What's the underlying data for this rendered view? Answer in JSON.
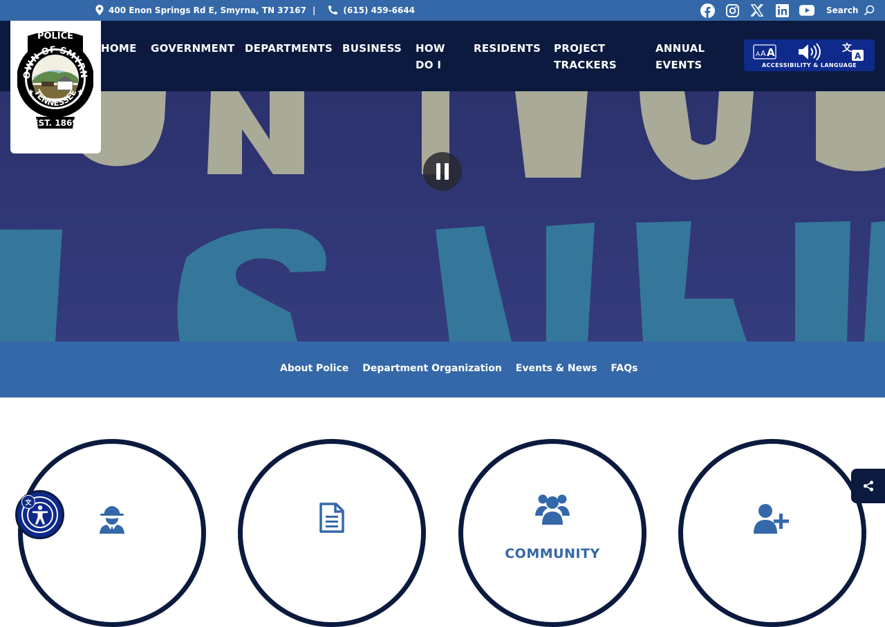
{
  "topbar": {
    "address": "400 Enon Springs Rd E, Smyrna, TN 37167",
    "separator": "|",
    "phone": "(615) 459-6644",
    "search_label": "Search",
    "social": [
      "facebook-icon",
      "instagram-icon",
      "x-icon",
      "linkedin-icon",
      "youtube-icon"
    ]
  },
  "logo": {
    "top_text": "POLICE",
    "ring_text": "TOWN OF SMYRNA",
    "bottom_text": "TENNESSEE",
    "est": "EST. 1869"
  },
  "nav": {
    "home": "HOME",
    "government": "GOVERNMENT",
    "departments": "DEPARTMENTS",
    "business": "BUSINESS",
    "how_do_i_1": "HOW",
    "how_do_i_2": "DO I",
    "residents": "RESIDENTS",
    "project_trackers_1": "PROJECT",
    "project_trackers_2": "TRACKERS",
    "annual_events_1": "ANNUAL",
    "annual_events_2": "EVENTS"
  },
  "accessibility": {
    "label": "ACCESSIBILITY & LANGUAGE"
  },
  "subnav": {
    "links": [
      "About Police",
      "Department Organization",
      "Events & News",
      "FAQs"
    ]
  },
  "circles": [
    {
      "icon": "detective-icon",
      "title": ""
    },
    {
      "icon": "document-icon",
      "title": ""
    },
    {
      "icon": "users-icon",
      "title": "COMMUNITY"
    },
    {
      "icon": "add-user-icon",
      "title": ""
    }
  ],
  "colors": {
    "topbar": "#3468a8",
    "header": "#0b1a3e",
    "accent": "#3468a8",
    "access_button": "#0e2a8a"
  }
}
